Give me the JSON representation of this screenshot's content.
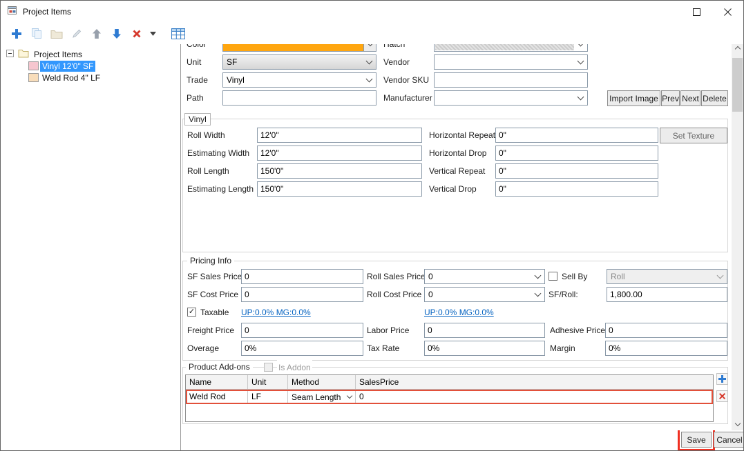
{
  "window": {
    "title": "Project Items"
  },
  "tree": {
    "root_label": "Project Items",
    "items": [
      {
        "label": "Vinyl 12'0\" SF",
        "swatch": "#f6c6cf",
        "selected": true
      },
      {
        "label": "Weld Rod 4\" LF",
        "swatch": "#f8ddba",
        "selected": false
      }
    ]
  },
  "form": {
    "color": {
      "label": "Color",
      "value_color": "#ffa60f"
    },
    "hatch": {
      "label": "Hatch"
    },
    "unit": {
      "label": "Unit",
      "value": "SF"
    },
    "vendor": {
      "label": "Vendor",
      "value": ""
    },
    "trade": {
      "label": "Trade",
      "value": "Vinyl"
    },
    "vendor_sku": {
      "label": "Vendor SKU",
      "value": ""
    },
    "path": {
      "label": "Path",
      "value": ""
    },
    "manufacturer": {
      "label": "Manufacturer",
      "value": ""
    },
    "import_image": "Import Image",
    "prev": "Prev",
    "next": "Next",
    "delete": "Delete"
  },
  "vinyl": {
    "title": "Vinyl",
    "left": [
      {
        "label": "Roll Width",
        "value": "12'0\""
      },
      {
        "label": "Estimating Width",
        "value": "12'0\""
      },
      {
        "label": "Roll Length",
        "value": "150'0\""
      },
      {
        "label": "Estimating Length",
        "value": "150'0\""
      }
    ],
    "right": [
      {
        "label": "Horizontal Repeat",
        "value": "0\""
      },
      {
        "label": "Horizontal Drop",
        "value": "0\""
      },
      {
        "label": "Vertical Repeat",
        "value": "0\""
      },
      {
        "label": "Vertical Drop",
        "value": "0\""
      }
    ],
    "set_texture": "Set Texture"
  },
  "pricing": {
    "title": "Pricing Info",
    "sf_sales_price": {
      "label": "SF Sales Price",
      "value": "0"
    },
    "sf_cost_price": {
      "label": "SF Cost Price",
      "value": "0"
    },
    "roll_sales_price": {
      "label": "Roll Sales Price",
      "value": "0"
    },
    "roll_cost_price": {
      "label": "Roll Cost Price",
      "value": "0"
    },
    "sell_by": {
      "label": "Sell By",
      "checked": false,
      "value": "Roll"
    },
    "sf_per_roll": {
      "label": "SF/Roll:",
      "value": "1,800.00"
    },
    "taxable": {
      "label": "Taxable",
      "checked": true
    },
    "markup_link_1": "UP:0.0% MG:0.0%",
    "markup_link_2": "UP:0.0% MG:0.0%",
    "freight_price": {
      "label": "Freight Price",
      "value": "0"
    },
    "labor_price": {
      "label": "Labor Price",
      "value": "0"
    },
    "adhesive_price": {
      "label": "Adhesive Price",
      "value": "0"
    },
    "overage": {
      "label": "Overage",
      "value": "0%"
    },
    "tax_rate": {
      "label": "Tax Rate",
      "value": "0%"
    },
    "margin": {
      "label": "Margin",
      "value": "0%"
    }
  },
  "addons": {
    "title": "Product Add-ons",
    "is_addon": {
      "label": "Is Addon",
      "checked": false
    },
    "columns": [
      "Name",
      "Unit",
      "Method",
      "SalesPrice"
    ],
    "rows": [
      {
        "name": "Weld Rod",
        "unit": "LF",
        "method": "Seam Length",
        "sales_price": "0"
      }
    ]
  },
  "footer": {
    "save": "Save",
    "cancel": "Cancel"
  },
  "colors": {
    "accent_blue": "#2e7bd2",
    "delete_red": "#d6392c",
    "selection_blue": "#3297fd",
    "highlight_red": "#f03022",
    "item_color": "#ffa60f"
  }
}
